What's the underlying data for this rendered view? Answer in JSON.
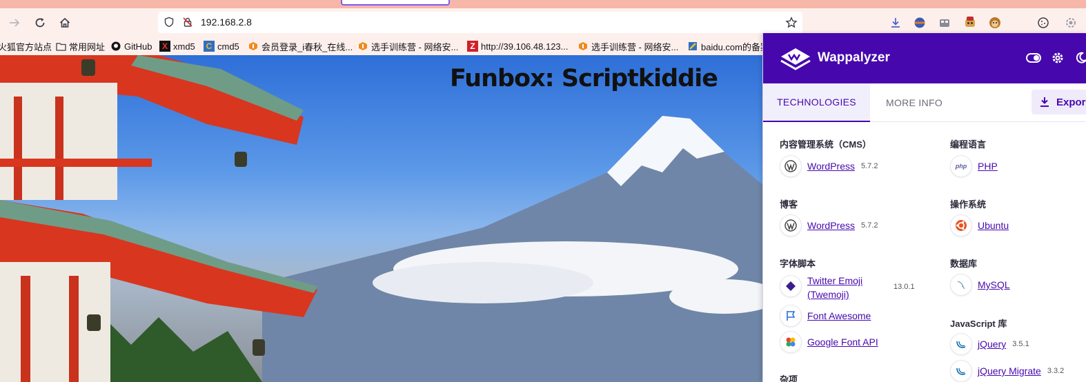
{
  "browser": {
    "url": "192.168.2.8",
    "bookmarks": [
      "火狐官方站点",
      "常用网址",
      "GitHub",
      "xmd5",
      "cmd5",
      "会员登录_i春秋_在线...",
      "选手训练营 - 网络安...",
      "http://39.106.48.123...",
      "选手训练营 - 网络安...",
      "baidu.com的备案"
    ]
  },
  "page": {
    "title": "Funbox: Scriptkiddie"
  },
  "wappalyzer": {
    "brand": "Wappalyzer",
    "tabs": [
      "TECHNOLOGIES",
      "MORE INFO"
    ],
    "export_label": "Expor",
    "left_column": [
      {
        "category": "内容管理系统（CMS）",
        "items": [
          {
            "name": "WordPress",
            "version": "5.7.2",
            "icon": "wordpress-icon"
          }
        ]
      },
      {
        "category": "博客",
        "items": [
          {
            "name": "WordPress",
            "version": "5.7.2",
            "icon": "wordpress-icon"
          }
        ]
      },
      {
        "category": "字体脚本",
        "items": [
          {
            "name": "Twitter Emoji",
            "name2": "(Twemoji)",
            "version": "13.0.1",
            "icon": "twemoji-icon"
          },
          {
            "name": "Font Awesome",
            "version": "",
            "icon": "font-awesome-icon"
          },
          {
            "name": "Google Font API",
            "version": "",
            "icon": "google-font-icon"
          }
        ]
      },
      {
        "category": "杂项",
        "items": []
      }
    ],
    "right_column": [
      {
        "category": "编程语言",
        "items": [
          {
            "name": "PHP",
            "version": "",
            "icon": "php-icon"
          }
        ]
      },
      {
        "category": "操作系统",
        "items": [
          {
            "name": "Ubuntu",
            "version": "",
            "icon": "ubuntu-icon"
          }
        ]
      },
      {
        "category": "数据库",
        "items": [
          {
            "name": "MySQL",
            "version": "",
            "icon": "mysql-icon"
          }
        ]
      },
      {
        "category": "JavaScript 库",
        "items": [
          {
            "name": "jQuery",
            "version": "3.5.1",
            "icon": "jquery-icon"
          },
          {
            "name": "jQuery Migrate",
            "version": "3.3.2",
            "icon": "jquery-icon"
          }
        ]
      }
    ],
    "colors": {
      "brand": "#4608ad",
      "link": "#4608ad"
    }
  }
}
